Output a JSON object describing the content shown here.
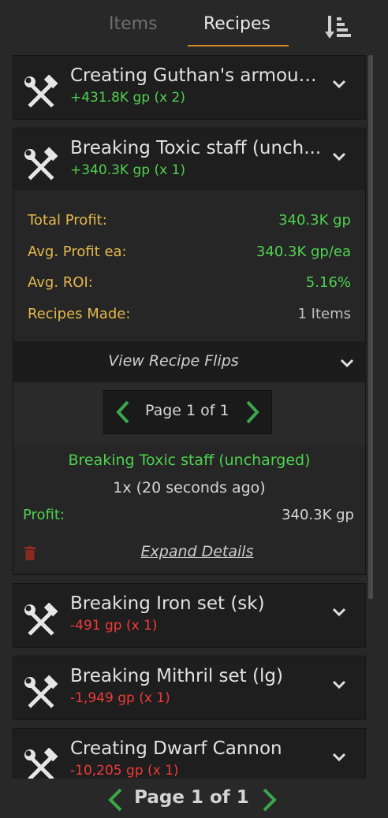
{
  "tabs": {
    "items": "Items",
    "recipes": "Recipes",
    "active": "Recipes"
  },
  "recipes": [
    {
      "title": "Creating Guthan's armour ...",
      "profit": "+431.8K gp (x 2)",
      "sign": "positive",
      "expanded": false
    },
    {
      "title": "Breaking Toxic staff (unch...",
      "profit": "+340.3K gp (x 1)",
      "sign": "positive",
      "expanded": true
    },
    {
      "title": "Breaking Iron set (sk)",
      "profit": "-491 gp (x 1)",
      "sign": "negative",
      "expanded": false
    },
    {
      "title": "Breaking Mithril set (lg)",
      "profit": "-1,949 gp (x 1)",
      "sign": "negative",
      "expanded": false
    },
    {
      "title": "Creating Dwarf Cannon",
      "profit": "-10,205 gp (x 1)",
      "sign": "negative",
      "expanded": false
    }
  ],
  "stats": {
    "total_profit_label": "Total Profit:",
    "total_profit_value": "340.3K gp",
    "avg_profit_label": "Avg. Profit ea:",
    "avg_profit_value": "340.3K gp/ea",
    "avg_roi_label": "Avg. ROI:",
    "avg_roi_value": "5.16%",
    "recipes_made_label": "Recipes Made:",
    "recipes_made_value": "1 Items"
  },
  "flips": {
    "view_label": "View Recipe Flips",
    "pager_text": "Page 1 of 1",
    "entry": {
      "title": "Breaking Toxic staff (uncharged)",
      "qty_time": "1x (20 seconds ago)",
      "profit_label": "Profit:",
      "profit_value": "340.3K gp",
      "expand_label": "Expand Details"
    }
  },
  "bottom_pager": {
    "text": "Page 1 of 1"
  },
  "icons": {
    "recipe": "hammer-wrench-icon",
    "expand": "chevron-down-icon",
    "prev": "chevron-left-icon",
    "next": "chevron-right-icon",
    "sort": "sort-descending-icon",
    "delete": "trash-icon"
  },
  "colors": {
    "profit_positive": "#4fd14f",
    "profit_negative": "#ee3b3b",
    "stat_label": "#e5b84a",
    "tab_underline": "#d08a2a"
  }
}
